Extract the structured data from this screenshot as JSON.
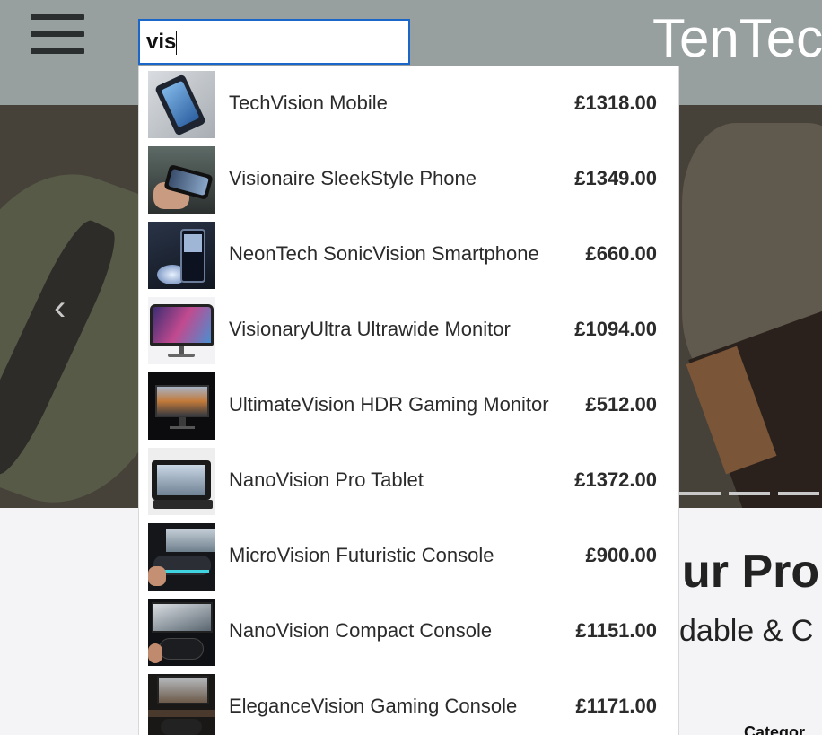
{
  "header": {
    "brand": "TenTec",
    "menu_icon": "hamburger-icon"
  },
  "search": {
    "value": "vis",
    "placeholder": ""
  },
  "results": [
    {
      "name": "TechVision Mobile",
      "price": "£1318.00",
      "thumb": "phone"
    },
    {
      "name": "Visionaire SleekStyle Phone",
      "price": "£1349.00",
      "thumb": "phone-hand"
    },
    {
      "name": "NeonTech SonicVision Smartphone",
      "price": "£660.00",
      "thumb": "phone-neon"
    },
    {
      "name": "VisionaryUltra Ultrawide Monitor",
      "price": "£1094.00",
      "thumb": "monitor-curved"
    },
    {
      "name": "UltimateVision HDR Gaming Monitor",
      "price": "£512.00",
      "thumb": "monitor"
    },
    {
      "name": "NanoVision Pro Tablet",
      "price": "£1372.00",
      "thumb": "tablet"
    },
    {
      "name": "MicroVision Futuristic Console",
      "price": "£900.00",
      "thumb": "console"
    },
    {
      "name": "NanoVision Compact Console",
      "price": "£1151.00",
      "thumb": "console"
    },
    {
      "name": "EleganceVision Gaming Console",
      "price": "£1171.00",
      "thumb": "console"
    }
  ],
  "hero": {
    "prev_icon": "chevron-left-icon"
  },
  "section": {
    "title": "ur Pro",
    "subtitle": "dable & C",
    "category_label": "Categor"
  }
}
